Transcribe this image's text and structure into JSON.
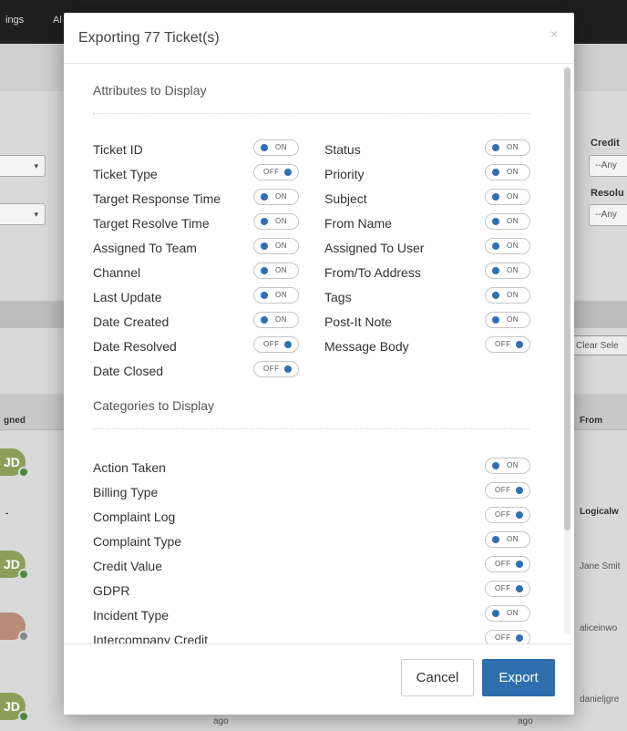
{
  "background": {
    "topbar_items": [
      "ings",
      "Al"
    ],
    "right_labels": [
      "Credit",
      "Resolu"
    ],
    "right_selects": [
      "--Any",
      "--Any"
    ],
    "clear_button": "Clear Sele",
    "columns": {
      "assigned": "gned",
      "from": "From"
    },
    "avatar_initials": "JD",
    "dash": "-",
    "rows_from": [
      "Logicalw",
      "Jane Smit",
      "aliceinwo",
      "danieljgre"
    ],
    "ago_label": "ago"
  },
  "modal": {
    "title": "Exporting 77 Ticket(s)",
    "close_icon": "×",
    "toggle_on_label": "ON",
    "toggle_off_label": "OFF",
    "attributes_title": "Attributes to Display",
    "attributes_left": [
      {
        "label": "Ticket ID",
        "on": true
      },
      {
        "label": "Ticket Type",
        "on": false
      },
      {
        "label": "Target Response Time",
        "on": true
      },
      {
        "label": "Target Resolve Time",
        "on": true
      },
      {
        "label": "Assigned To Team",
        "on": true
      },
      {
        "label": "Channel",
        "on": true
      },
      {
        "label": "Last Update",
        "on": true
      },
      {
        "label": "Date Created",
        "on": true
      },
      {
        "label": "Date Resolved",
        "on": false
      },
      {
        "label": "Date Closed",
        "on": false
      }
    ],
    "attributes_right": [
      {
        "label": "Status",
        "on": true
      },
      {
        "label": "Priority",
        "on": true
      },
      {
        "label": "Subject",
        "on": true
      },
      {
        "label": "From Name",
        "on": true
      },
      {
        "label": "Assigned To User",
        "on": true
      },
      {
        "label": "From/To Address",
        "on": true
      },
      {
        "label": "Tags",
        "on": true
      },
      {
        "label": "Post-It Note",
        "on": true
      },
      {
        "label": "Message Body",
        "on": false
      }
    ],
    "categories_title": "Categories to Display",
    "categories": [
      {
        "label": "Action Taken",
        "on": true
      },
      {
        "label": "Billing Type",
        "on": false
      },
      {
        "label": "Complaint Log",
        "on": false
      },
      {
        "label": "Complaint Type",
        "on": true
      },
      {
        "label": "Credit Value",
        "on": false
      },
      {
        "label": "GDPR",
        "on": false
      },
      {
        "label": "Incident Type",
        "on": true
      },
      {
        "label": "Intercompany Credit",
        "on": false
      }
    ],
    "cancel_label": "Cancel",
    "export_label": "Export"
  },
  "colors": {
    "accent": "#2d6fae",
    "toggle_dot": "#2f6fb7",
    "backdrop": "#7a7a7a"
  }
}
